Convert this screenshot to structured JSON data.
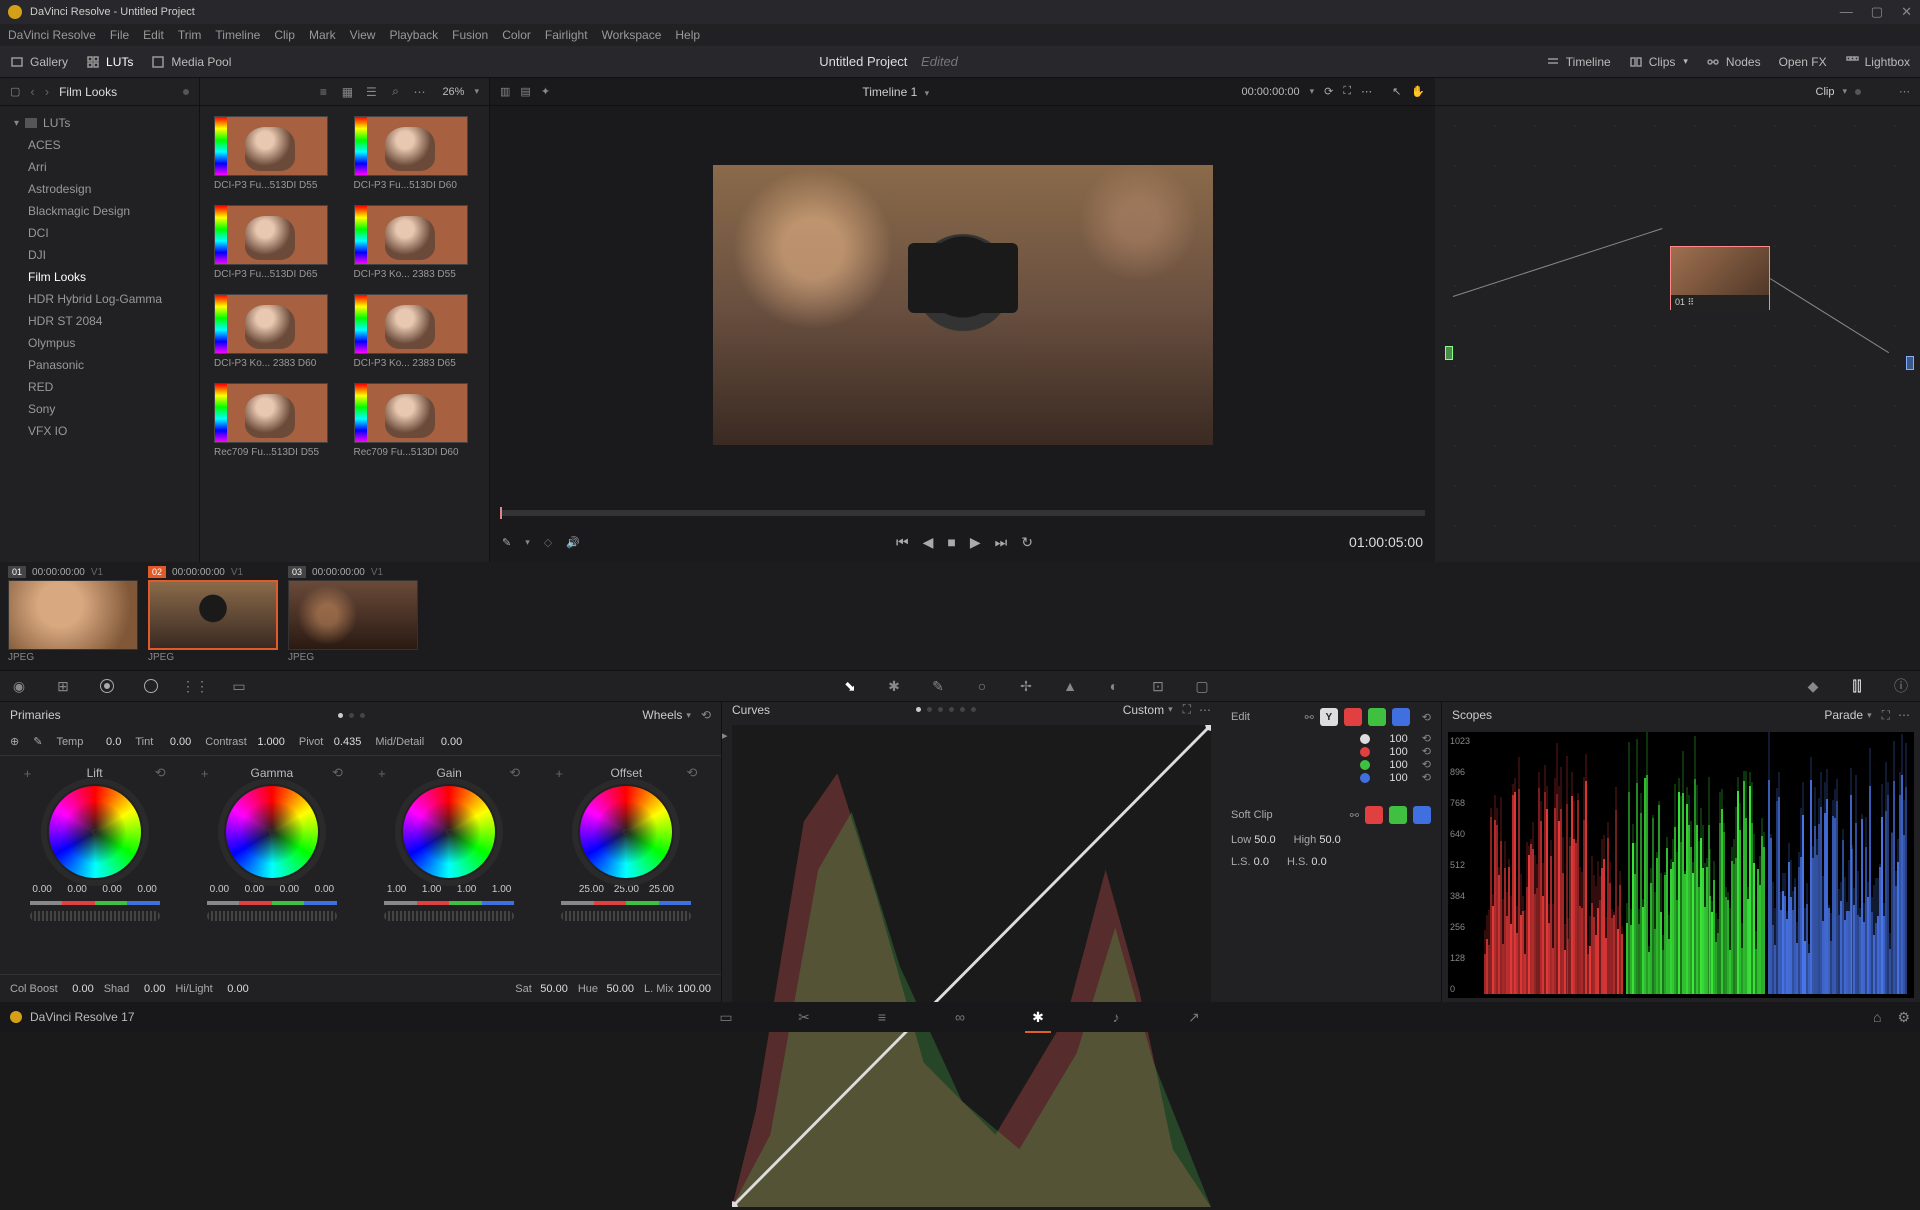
{
  "window": {
    "title": "DaVinci Resolve - Untitled Project"
  },
  "menu": [
    "DaVinci Resolve",
    "File",
    "Edit",
    "Trim",
    "Timeline",
    "Clip",
    "Mark",
    "View",
    "Playback",
    "Fusion",
    "Color",
    "Fairlight",
    "Workspace",
    "Help"
  ],
  "toolbar": {
    "gallery": "Gallery",
    "luts": "LUTs",
    "mediaPool": "Media Pool",
    "projectTitle": "Untitled Project",
    "status": "Edited",
    "timeline": "Timeline",
    "clips": "Clips",
    "nodes": "Nodes",
    "openfx": "Open FX",
    "lightbox": "Lightbox"
  },
  "browser": {
    "title": "Film Looks",
    "root": "LUTs",
    "folders": [
      "ACES",
      "Arri",
      "Astrodesign",
      "Blackmagic Design",
      "DCI",
      "DJI",
      "Film Looks",
      "HDR Hybrid Log-Gamma",
      "HDR ST 2084",
      "Olympus",
      "Panasonic",
      "RED",
      "Sony",
      "VFX IO"
    ],
    "selectedFolder": "Film Looks",
    "zoom": "26%"
  },
  "luts": [
    {
      "name": "DCI-P3 Fu...513DI D55"
    },
    {
      "name": "DCI-P3 Fu...513DI D60"
    },
    {
      "name": "DCI-P3 Fu...513DI D65"
    },
    {
      "name": "DCI-P3 Ko... 2383 D55"
    },
    {
      "name": "DCI-P3 Ko... 2383 D60"
    },
    {
      "name": "DCI-P3 Ko... 2383 D65"
    },
    {
      "name": "Rec709 Fu...513DI D55"
    },
    {
      "name": "Rec709 Fu...513DI D60"
    }
  ],
  "viewer": {
    "timelineName": "Timeline 1",
    "headerTC": "00:00:00:00",
    "playTC": "01:00:05:00"
  },
  "nodePanel": {
    "mode": "Clip",
    "nodeLabel": "01"
  },
  "clips": [
    {
      "num": "01",
      "tc": "00:00:00:00",
      "track": "V1",
      "type": "JPEG"
    },
    {
      "num": "02",
      "tc": "00:00:00:00",
      "track": "V1",
      "type": "JPEG"
    },
    {
      "num": "03",
      "tc": "00:00:00:00",
      "track": "V1",
      "type": "JPEG"
    }
  ],
  "primaries": {
    "title": "Primaries",
    "mode": "Wheels",
    "temp": {
      "label": "Temp",
      "value": "0.0"
    },
    "tint": {
      "label": "Tint",
      "value": "0.00"
    },
    "contrast": {
      "label": "Contrast",
      "value": "1.000"
    },
    "pivot": {
      "label": "Pivot",
      "value": "0.435"
    },
    "middetail": {
      "label": "Mid/Detail",
      "value": "0.00"
    },
    "wheels": [
      {
        "name": "Lift",
        "vals": [
          "0.00",
          "0.00",
          "0.00",
          "0.00"
        ]
      },
      {
        "name": "Gamma",
        "vals": [
          "0.00",
          "0.00",
          "0.00",
          "0.00"
        ]
      },
      {
        "name": "Gain",
        "vals": [
          "1.00",
          "1.00",
          "1.00",
          "1.00"
        ]
      },
      {
        "name": "Offset",
        "vals": [
          "25.00",
          "25.00",
          "25.00"
        ]
      }
    ],
    "footer": {
      "colboost": {
        "label": "Col Boost",
        "value": "0.00"
      },
      "shad": {
        "label": "Shad",
        "value": "0.00"
      },
      "hilight": {
        "label": "Hi/Light",
        "value": "0.00"
      },
      "sat": {
        "label": "Sat",
        "value": "50.00"
      },
      "hue": {
        "label": "Hue",
        "value": "50.00"
      },
      "lmix": {
        "label": "L. Mix",
        "value": "100.00"
      }
    }
  },
  "curves": {
    "title": "Curves",
    "mode": "Custom",
    "editLabel": "Edit",
    "channels": [
      {
        "color": "#ddd",
        "value": "100"
      },
      {
        "color": "#e04040",
        "value": "100"
      },
      {
        "color": "#40c040",
        "value": "100"
      },
      {
        "color": "#4070e0",
        "value": "100"
      }
    ],
    "softclip": {
      "label": "Soft Clip",
      "low": {
        "label": "Low",
        "value": "50.0"
      },
      "high": {
        "label": "High",
        "value": "50.0"
      },
      "ls": {
        "label": "L.S.",
        "value": "0.0"
      },
      "hs": {
        "label": "H.S.",
        "value": "0.0"
      }
    }
  },
  "scopes": {
    "title": "Scopes",
    "mode": "Parade",
    "ticks": [
      "1023",
      "896",
      "768",
      "640",
      "512",
      "384",
      "256",
      "128",
      "0"
    ]
  },
  "statusbar": {
    "app": "DaVinci Resolve 17"
  }
}
